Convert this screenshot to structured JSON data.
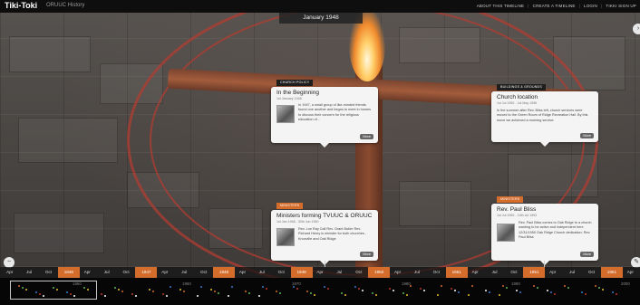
{
  "header": {
    "logo": "Tiki-Toki",
    "timeline_title": "ORUUC History",
    "nav": [
      "ABOUT THIS TIMELINE",
      "CREATE A TIMELINE",
      "LOGIN",
      "TIKKI SIGN UP"
    ]
  },
  "current_date": "January 1948",
  "colors": {
    "accent": "#d46c2c",
    "topbar": "#0e0e0e"
  },
  "cards": [
    {
      "category": "CHURCH POLICY",
      "title": "In the Beginning",
      "date": "1st January 1948",
      "text": "In 1947, a small group of like-minded friends found one another and began to meet in homes to discuss their concern for the religious education of...",
      "more": "More"
    },
    {
      "category": "BUILDINGS & GROUNDS",
      "title": "Church location",
      "date": "1st Jul 1950 - 1st May 1956",
      "text": "In the summer after Rev. Bliss left, church services were moved to the Green Room of Ridge Recreation Hall. By this move we achieved a morning service.",
      "more": "More"
    },
    {
      "category": "MINISTERS",
      "title": "Ministers forming TVUUC & ORUUC",
      "date": "1st Jan 1948 - 30th Jun 1950",
      "text": "Rev. Lon Ray Call Rev. Grant Butler Rev. Richard Henry is minister for both churches - Knoxville and Oak Ridge",
      "more": "More"
    },
    {
      "category": "MINISTERS",
      "title": "Rev. Paul Bliss",
      "date": "1st Jul 1950 - 14th Jul 1953",
      "text": "Rev. Paul Bliss comes to Oak Ridge to a church wanting to be active and independent here 12/31/1950 Oak Ridge Church dedication. Rev. Paul Bliss",
      "more": "More"
    }
  ],
  "timeline": {
    "ticks": [
      "Apr",
      "Jul",
      "Oct",
      "1946",
      "Apr",
      "Jul",
      "Oct",
      "1947",
      "Apr",
      "Jul",
      "Oct",
      "1948",
      "Apr",
      "Jul",
      "Oct",
      "1949",
      "Apr",
      "Jul",
      "Oct",
      "1950",
      "Apr",
      "Jul",
      "Oct",
      "1951",
      "Apr",
      "Jul",
      "Oct",
      "1951",
      "Apr",
      "Jul",
      "Oct",
      "1951",
      "Apr"
    ],
    "year_flags": [
      3,
      7,
      11,
      15,
      19,
      23,
      27,
      31
    ],
    "decades": [
      "1950",
      "1960",
      "1970",
      "1980",
      "1990",
      "2000"
    ]
  },
  "side_buttons": {
    "left": "‹",
    "right": "›",
    "zoom_out": "−",
    "search": "✎"
  }
}
